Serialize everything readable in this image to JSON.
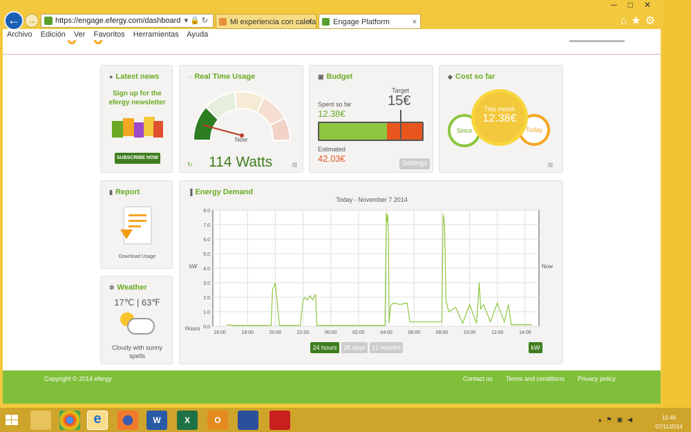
{
  "browser": {
    "url": "https://engage.efergy.com/dashboard",
    "tab1_label": "Mi experiencia con calefacción...",
    "tab2_label": "Engage Platform"
  },
  "menu": [
    "Archivo",
    "Edición",
    "Ver",
    "Favoritos",
    "Herramientas",
    "Ayuda"
  ],
  "news": {
    "title": "Latest news",
    "line1": "Sign up for the",
    "line2": "efergy newsletter",
    "button": "SUBSCRIBE NOW"
  },
  "realtime": {
    "title": "Real Time Usage",
    "needle_label": "Now",
    "value": "114 Watts"
  },
  "budget": {
    "title": "Budget",
    "spent_label": "Spent so far",
    "spent": "12.38€",
    "target_label": "Target",
    "target": "15€",
    "estimated_label": "Estimated",
    "estimated": "42.03€",
    "settings": "Settings",
    "spent_fraction": 0.66
  },
  "cost": {
    "title": "Cost so far",
    "month_label": "This month",
    "month_value": "12.38€",
    "since_label": "Since",
    "today_label": "Today"
  },
  "report": {
    "title": "Report",
    "caption": "Download Usage"
  },
  "weather": {
    "title": "Weather",
    "temps": "17℃ | 63℉",
    "desc_line1": "Cloudy with sunny",
    "desc_line2": "spells"
  },
  "energy": {
    "title": "Energy Demand",
    "range_24": "24 hours",
    "range_28": "28 days",
    "range_12": "12 months",
    "unit_btn": "kW"
  },
  "footer": {
    "copyright": "Copyright © 2014 efergy",
    "contact": "Contact us",
    "terms": "Terms and conditions",
    "privacy": "Privacy policy"
  },
  "clock": {
    "time": "15:46",
    "date": "07/11/2014"
  },
  "chart_data": {
    "type": "line",
    "title": "Today - November 7 2014",
    "ylabel": "kW",
    "xlabel": "Hours",
    "right_label": "Now",
    "ylim": [
      0,
      8
    ],
    "yticks": [
      "0.0",
      "1.0",
      "2.0",
      "3.0",
      "4.0",
      "5.0",
      "6.0",
      "7.0",
      "8.0"
    ],
    "xticks": [
      "16:00",
      "18:00",
      "20:00",
      "22:00",
      "00:00",
      "02:00",
      "04:00",
      "06:00",
      "08:00",
      "10:00",
      "12:00",
      "14:00"
    ],
    "x": [
      16.5,
      17,
      18,
      19,
      19.7,
      19.8,
      20,
      20.1,
      20.3,
      20.6,
      21,
      21.8,
      22,
      22.1,
      22.3,
      22.5,
      22.7,
      22.9,
      23,
      24,
      25,
      26,
      27,
      27.9,
      28,
      28.05,
      28.1,
      28.15,
      28.2,
      28.3,
      28.5,
      29,
      29.5,
      29.7,
      30,
      31,
      32,
      32.1,
      32.2,
      32.3,
      32.5,
      33,
      33.5,
      34,
      34.5,
      34.7,
      34.8,
      35,
      35.5,
      36,
      36.5,
      36.8,
      37,
      38,
      38.5
    ],
    "values": [
      0.1,
      0.05,
      0.05,
      0.05,
      0.05,
      2.5,
      3.0,
      2.0,
      0.05,
      0.05,
      0.05,
      0.05,
      1.8,
      2.0,
      1.8,
      2.1,
      1.8,
      2.2,
      0.05,
      0.05,
      0.05,
      0.05,
      0.05,
      0.05,
      7.8,
      7.2,
      7.7,
      6.2,
      0.2,
      1.4,
      1.6,
      1.5,
      1.6,
      0.3,
      0.3,
      0.3,
      0.3,
      7.7,
      7.0,
      1.8,
      1.0,
      1.3,
      0.2,
      1.5,
      0.2,
      3.0,
      1.2,
      1.5,
      0.3,
      1.6,
      0.3,
      1.5,
      0.1,
      0.1,
      0.1
    ]
  }
}
